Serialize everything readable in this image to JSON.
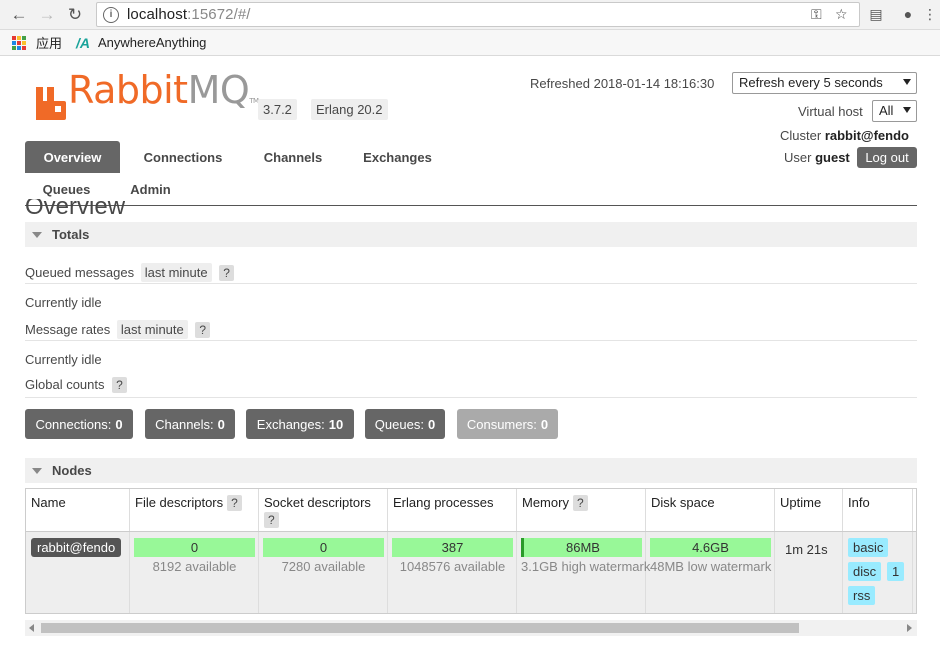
{
  "browser": {
    "url_host": "localhost",
    "url_rest": ":15672/#/",
    "bookmarks": [
      "应用",
      "AnywhereAnything"
    ]
  },
  "header": {
    "logo_rabbit": "Rabbit",
    "logo_mq": "MQ",
    "logo_tm": "TM",
    "version": "3.7.2",
    "erlang": "Erlang 20.2",
    "refreshed": "Refreshed 2018-01-14 18:16:30",
    "refresh_select": "Refresh every 5 seconds",
    "vhost_label": "Virtual host",
    "vhost_select": "All",
    "cluster_label": "Cluster",
    "cluster_name": "rabbit@fendo",
    "user_label": "User",
    "user_name": "guest",
    "logout": "Log out"
  },
  "tabs": [
    "Overview",
    "Connections",
    "Channels",
    "Exchanges",
    "Queues",
    "Admin"
  ],
  "page_title": "Overview",
  "totals": {
    "heading": "Totals",
    "queued_label": "Queued messages",
    "queued_chip": "last minute",
    "help": "?",
    "idle1": "Currently idle",
    "rates_label": "Message rates",
    "rates_chip": "last minute",
    "idle2": "Currently idle",
    "global_label": "Global counts"
  },
  "counts": [
    {
      "label": "Connections:",
      "value": "0"
    },
    {
      "label": "Channels:",
      "value": "0"
    },
    {
      "label": "Exchanges:",
      "value": "10"
    },
    {
      "label": "Queues:",
      "value": "0"
    },
    {
      "label": "Consumers:",
      "value": "0"
    }
  ],
  "nodes": {
    "heading": "Nodes",
    "columns": [
      "Name",
      "File descriptors",
      "Socket descriptors",
      "Erlang processes",
      "Memory",
      "Disk space",
      "Uptime",
      "Info"
    ],
    "row": {
      "name": "rabbit@fendo",
      "fd": "0",
      "fd_sub": "8192 available",
      "sd": "0",
      "sd_sub": "7280 available",
      "ep": "387",
      "ep_sub": "1048576 available",
      "mem": "86MB",
      "mem_sub": "3.1GB high watermark",
      "disk": "4.6GB",
      "disk_sub": "48MB low watermark",
      "uptime": "1m 21s",
      "info_tags": [
        "basic",
        "disc",
        "1",
        "rss"
      ]
    }
  },
  "colors": {
    "brand_orange": "#f06a27",
    "tab_active": "#666666",
    "bar_green": "#98f898",
    "tag_blue": "#99ebff"
  }
}
